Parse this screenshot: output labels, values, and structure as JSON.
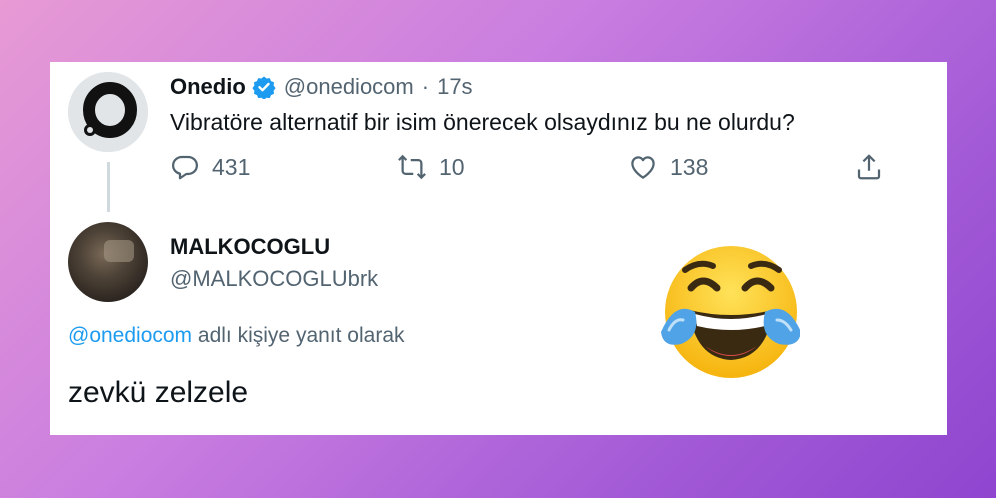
{
  "tweet": {
    "name": "Onedio",
    "handle": "@onediocom",
    "separator": "·",
    "time": "17s",
    "text": "Vibratöre alternatif bir isim önerecek olsaydınız bu ne olurdu?",
    "reply_count": "431",
    "retweet_count": "10",
    "like_count": "138"
  },
  "reply": {
    "name": "MALKOCOGLU",
    "handle": "@MALKOCOGLUbrk",
    "replying_to_handle": "@onediocom",
    "replying_to_suffix": "adlı kişiye yanıt olarak",
    "text": "zevkü zelzele"
  },
  "colors": {
    "link": "#1d9bf0",
    "secondary_text": "#536471",
    "primary_text": "#0f1419",
    "verified": "#1d9bf0"
  },
  "icons": {
    "reply": "reply-icon",
    "retweet": "retweet-icon",
    "like": "like-icon",
    "share": "share-icon",
    "verified": "verified-badge-icon",
    "emoji": "face-with-tears-of-joy-icon"
  }
}
